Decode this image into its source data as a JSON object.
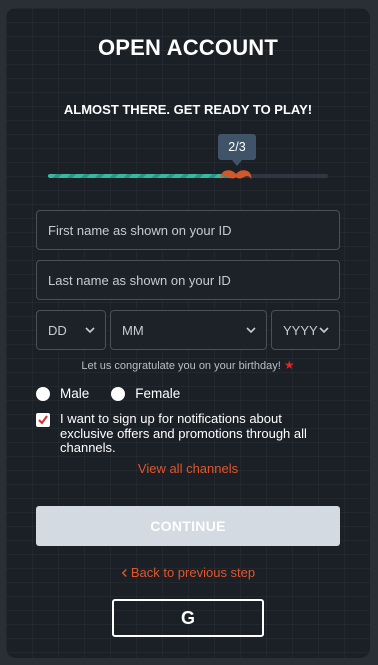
{
  "header": {
    "title": "OPEN ACCOUNT",
    "subtitle": "ALMOST THERE. GET READY TO PLAY!"
  },
  "progress": {
    "step_label": "2/3",
    "fraction_complete": 0.67
  },
  "form": {
    "first_name_placeholder": "First name as shown on your ID",
    "last_name_placeholder": "Last name as shown on your ID",
    "dob": {
      "day": "DD",
      "month": "MM",
      "year": "YYYY"
    },
    "birthday_hint": "Let us congratulate you on your birthday!",
    "gender_options": [
      "Male",
      "Female"
    ],
    "notifications_label": "I want to sign up for notifications about exclusive offers and promotions through all channels.",
    "notifications_checked": true,
    "view_channels_link": "View all channels",
    "continue_label": "CONTINUE",
    "back_link": "Back to previous step",
    "google_button": "G"
  },
  "colors": {
    "accent": "#e2562a",
    "progress": "#37b8a1",
    "background": "#1b1f26",
    "button_disabled": "#d3dae2"
  }
}
